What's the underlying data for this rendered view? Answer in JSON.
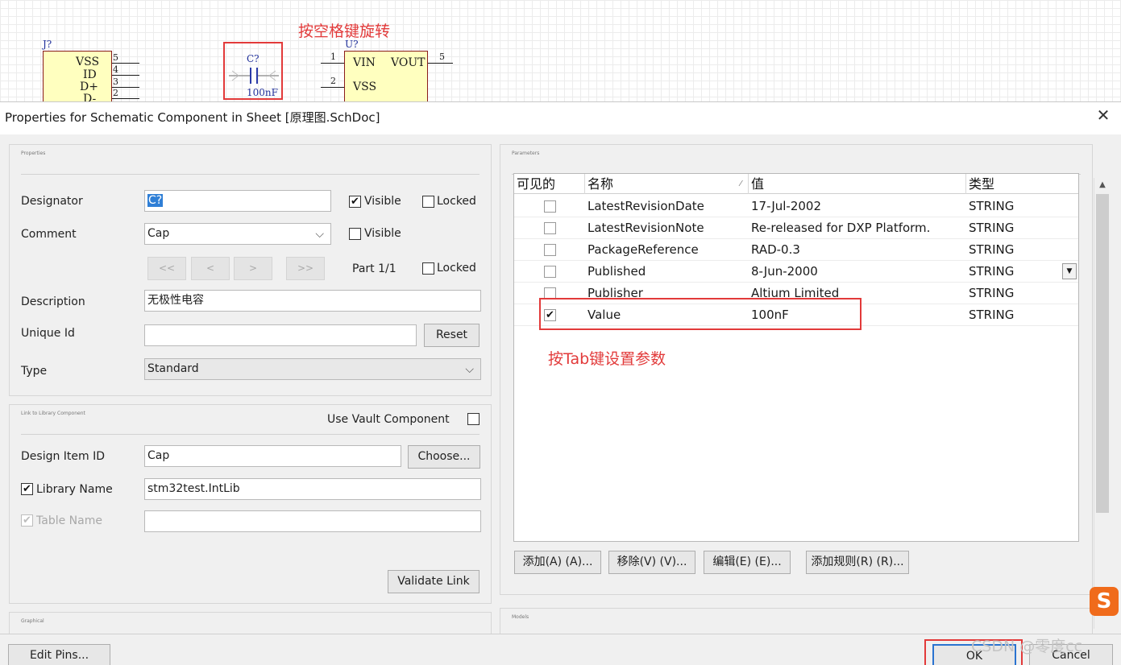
{
  "schematic": {
    "j_part": {
      "designator": "J?",
      "pins": [
        {
          "name": "VSS",
          "num": "5"
        },
        {
          "name": "ID",
          "num": "4"
        },
        {
          "name": "D+",
          "num": "3"
        },
        {
          "name": "D-",
          "num": "2"
        }
      ]
    },
    "c_part": {
      "designator": "C?",
      "value": "100nF"
    },
    "u_part": {
      "designator": "U?",
      "pin1_num": "1",
      "pin1_name": "VIN",
      "pin2_num": "2",
      "pin2_name": "VSS",
      "out_name": "VOUT",
      "out_num": "5"
    },
    "annotation_rotate": "按空格键旋转"
  },
  "dialog": {
    "title": "Properties for Schematic Component in Sheet [原理图.SchDoc]",
    "close_glyph": "✕"
  },
  "properties": {
    "panel_title": "Properties",
    "designator_label": "Designator",
    "designator_value": "C?",
    "designator_visible": "Visible",
    "designator_locked": "Locked",
    "comment_label": "Comment",
    "comment_value": "Cap",
    "comment_visible": "Visible",
    "nav_first": "<<",
    "nav_prev": "<",
    "nav_next": ">",
    "nav_last": ">>",
    "part_label": "Part 1/1",
    "part_locked": "Locked",
    "description_label": "Description",
    "description_value": "无极性电容",
    "unique_id_label": "Unique Id",
    "unique_id_value": "",
    "reset_button": "Reset",
    "type_label": "Type",
    "type_value": "Standard"
  },
  "link": {
    "panel_title": "Link to Library Component",
    "use_vault": "Use Vault Component",
    "design_item_label": "Design Item ID",
    "design_item_value": "Cap",
    "choose_button": "Choose...",
    "library_name_label": "Library Name",
    "library_name_value": "stm32test.IntLib",
    "table_name_label": "Table Name",
    "table_name_value": "",
    "validate_button": "Validate Link"
  },
  "graphical": {
    "panel_title": "Graphical"
  },
  "models": {
    "panel_title": "Models"
  },
  "parameters": {
    "panel_title": "Parameters",
    "columns": [
      "可见的",
      "名称",
      "值",
      "类型"
    ],
    "sort_glyph": "⁄",
    "rows": [
      {
        "visible": false,
        "name": "LatestRevisionDate",
        "value": "17-Jul-2002",
        "type": "STRING"
      },
      {
        "visible": false,
        "name": "LatestRevisionNote",
        "value": "Re-released for DXP Platform.",
        "type": "STRING"
      },
      {
        "visible": false,
        "name": "PackageReference",
        "value": "RAD-0.3",
        "type": "STRING"
      },
      {
        "visible": false,
        "name": "Published",
        "value": "8-Jun-2000",
        "type": "STRING"
      },
      {
        "visible": false,
        "name": "Publisher",
        "value": "Altium Limited",
        "type": "STRING"
      },
      {
        "visible": true,
        "name": "Value",
        "value": "100nF",
        "type": "STRING"
      }
    ],
    "annotation_tab": "按Tab键设置参数",
    "add_button": "添加(A) (A)...",
    "remove_button": "移除(V) (V)...",
    "edit_button": "编辑(E) (E)...",
    "add_rule_button": "添加规则(R) (R)..."
  },
  "footer": {
    "edit_pins_button": "Edit Pins...",
    "ok_button": "OK",
    "cancel_button": "Cancel"
  },
  "overlay": {
    "ime_logo": "S",
    "watermark": "CSDN @零度cc"
  },
  "colors": {
    "accent_red": "#e23a3a",
    "selection_blue": "#2f7fd6",
    "part_fill": "#ffffbf"
  }
}
